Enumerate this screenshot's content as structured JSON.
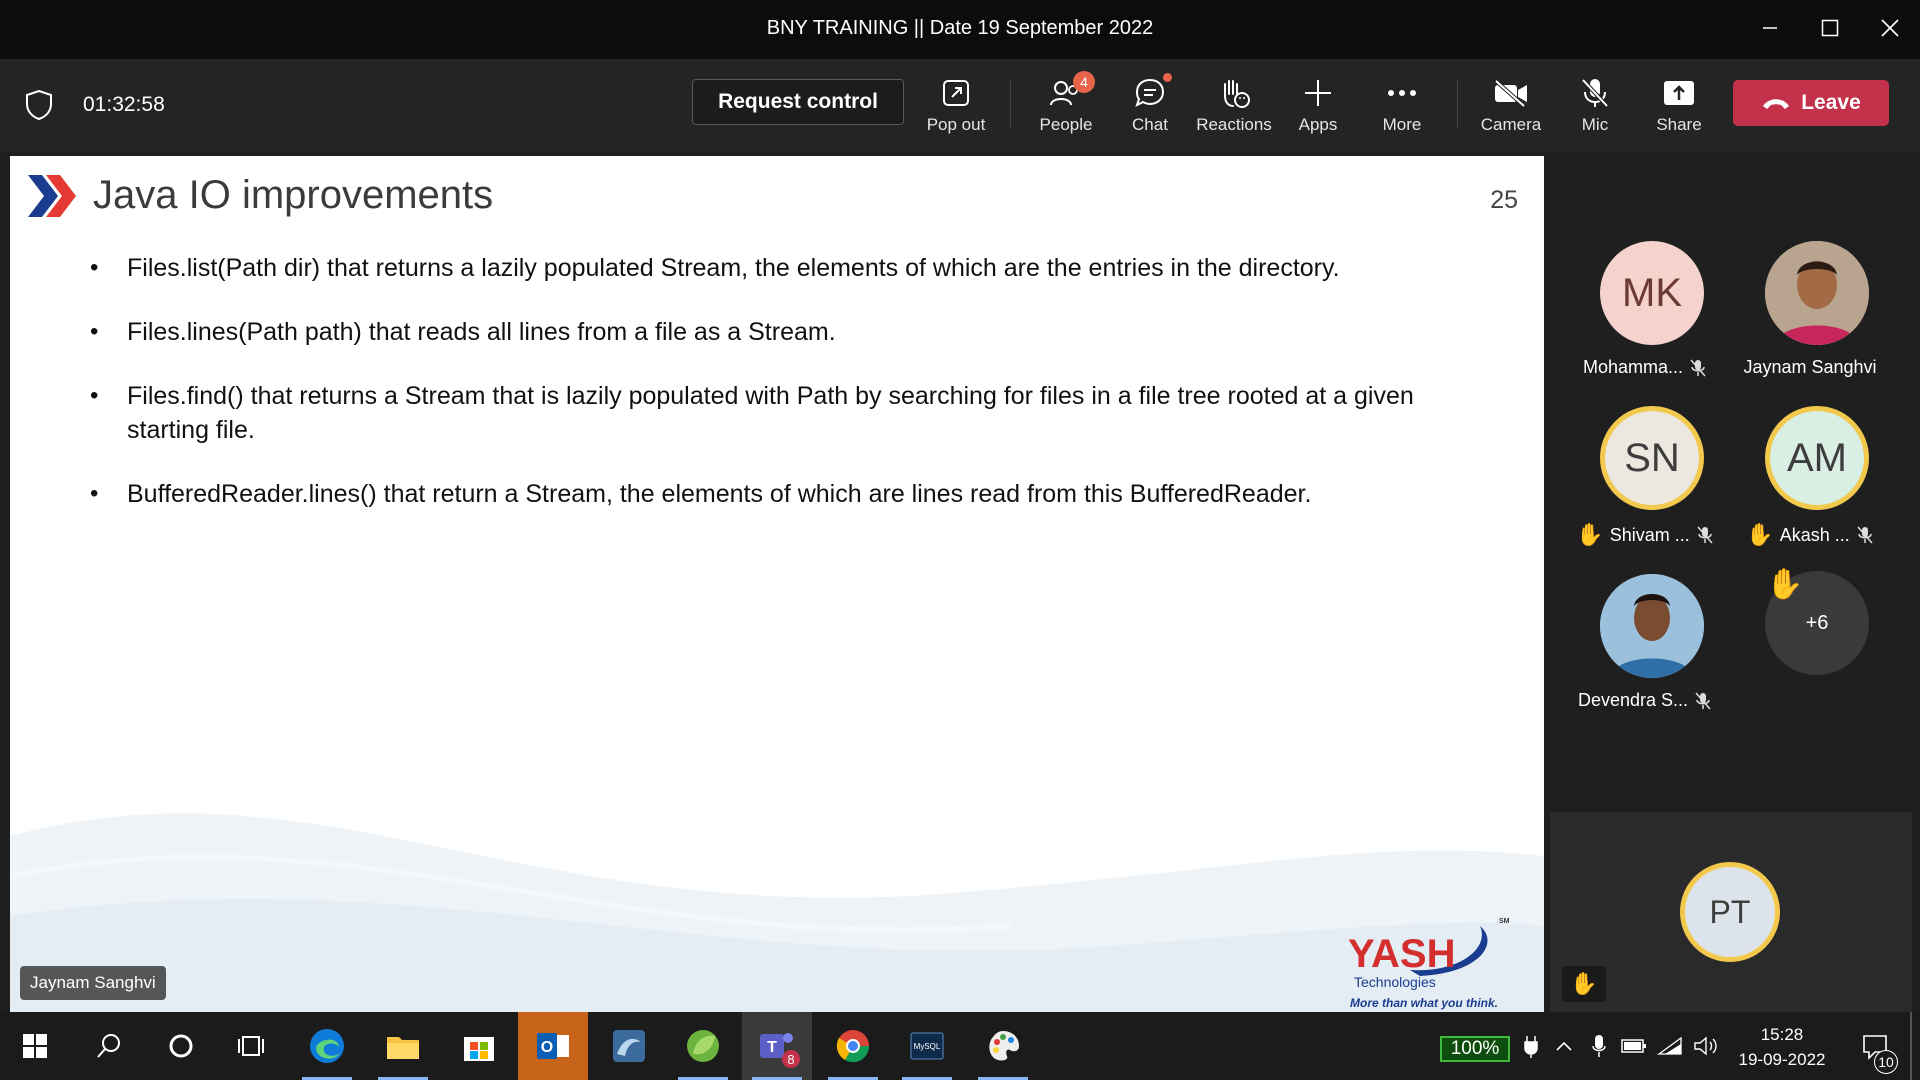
{
  "window": {
    "title": "BNY TRAINING || Date 19 September 2022"
  },
  "toolbar": {
    "timer": "01:32:58",
    "request_control": "Request control",
    "pop_out": "Pop out",
    "people": "People",
    "people_badge": "4",
    "chat": "Chat",
    "reactions": "Reactions",
    "apps": "Apps",
    "more": "More",
    "camera": "Camera",
    "mic": "Mic",
    "share": "Share",
    "leave": "Leave"
  },
  "slide": {
    "title": "Java IO improvements",
    "page_number": "25",
    "bullets": [
      "Files.list(Path dir) that returns a lazily populated Stream, the elements of which are the entries in the directory.",
      "Files.lines(Path path) that reads all lines from a file as a Stream.",
      "Files.find() that returns a Stream that is lazily populated with Path by searching for files in a file tree rooted at a given starting file.",
      "BufferedReader.lines() that return a Stream, the elements of which are lines read from this BufferedReader."
    ],
    "logo_text": "YASH",
    "logo_sub": "Technologies",
    "logo_tagline": "More than what you think.",
    "logo_sm": "SM"
  },
  "presenter_label": "Jaynam Sanghvi",
  "participants": [
    {
      "initials": "MK",
      "name": "Mohamma...",
      "muted": true,
      "hand": false
    },
    {
      "initials": "",
      "name": "Jaynam Sanghvi",
      "muted": false,
      "hand": false
    },
    {
      "initials": "SN",
      "name": "Shivam ...",
      "muted": true,
      "hand": true
    },
    {
      "initials": "AM",
      "name": "Akash ...",
      "muted": true,
      "hand": true
    },
    {
      "initials": "",
      "name": "Devendra S...",
      "muted": true,
      "hand": false
    }
  ],
  "overflow_count": "+6",
  "self_view": {
    "initials": "PT"
  },
  "taskbar": {
    "battery": "100%",
    "time": "15:28",
    "date": "19-09-2022",
    "notifications": "10",
    "teams_badge": "8"
  },
  "colors": {
    "accent": "#7f85f5",
    "leave": "#c4314b",
    "hand": "#f2c94c"
  }
}
